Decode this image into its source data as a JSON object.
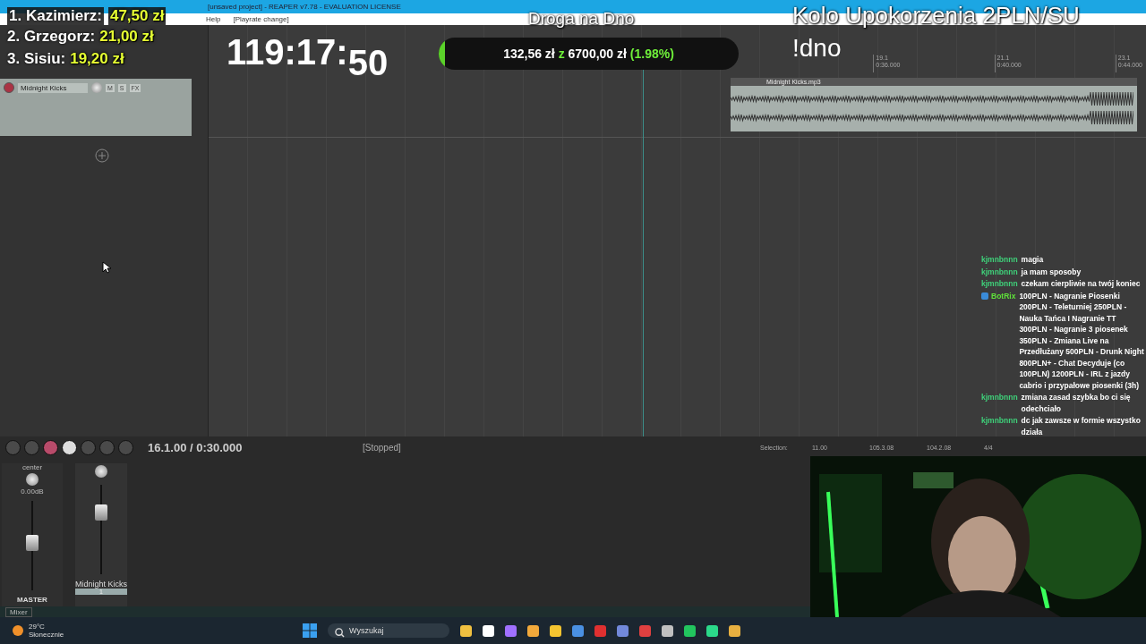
{
  "window": {
    "title": "[unsaved project] - REAPER v7.78 - EVALUATION LICENSE"
  },
  "menu": [
    "Help",
    "[Playrate change]"
  ],
  "overlay": {
    "donors": [
      {
        "rank": "1. Kazimierz:",
        "amount": "47,50 zł"
      },
      {
        "rank": "2. Grzegorz:",
        "amount": "21,00 zł"
      },
      {
        "rank": "3. Sisiu:",
        "amount": "19,20 zł"
      }
    ],
    "timer": "119:17:",
    "timer_seconds": "50",
    "stream_title": "Droga na Dno",
    "wheel_title": "Kolo Upokorzenia 2PLN/SU",
    "command": "!dno",
    "goal": {
      "current": "132,56 zł",
      "joiner": "z",
      "target": "6700,00 zł",
      "percent": "(1.98%)",
      "level": 0.0198
    }
  },
  "ruler": [
    {
      "bar": "19.1",
      "time": "0:36.000"
    },
    {
      "bar": "21.1",
      "time": "0:40.000"
    },
    {
      "bar": "23.1",
      "time": "0:44.000"
    }
  ],
  "track": {
    "name": "Midnight Kicks",
    "buttons": [
      "M",
      "S",
      "FX"
    ],
    "item": "Midnight Kicks.mp3"
  },
  "transport": {
    "position": "16.1.00 / 0:30.000",
    "state": "[Stopped]",
    "selection_label": "Selection:",
    "selection": [
      "11.00",
      "105.3.08",
      "104.2.08"
    ],
    "signature": "4/4"
  },
  "mixer": {
    "master": {
      "pan": "center",
      "volume": "0.00dB",
      "name": "MASTER",
      "level": 0.55
    },
    "channel": {
      "name": "Midnight Kicks",
      "number": "1",
      "level": 0.75
    },
    "tab": "Mixer"
  },
  "chat": [
    {
      "user": "kjmnbnnn",
      "color": "#3fd17a",
      "bot": false,
      "text": "magia"
    },
    {
      "user": "kjmnbnnn",
      "color": "#3fd17a",
      "bot": false,
      "text": "ja mam sposoby"
    },
    {
      "user": "kjmnbnnn",
      "color": "#3fd17a",
      "bot": false,
      "text": "czekam cierpliwie na twój koniec"
    },
    {
      "user": "BotRix",
      "color": "#5fe03a",
      "bot": true,
      "text": "100PLN - Nagranie Piosenki 200PLN - Teleturniej 250PLN - Nauka Tańca I Nagranie TT 300PLN - Nagranie 3 piosenek 350PLN - Zmiana Live na Przedłużany 500PLN - Drunk Night 800PLN+ - Chat Decyduje (co 100PLN) 1200PLN - IRL z jazdy cabrio i przypałowe piosenki (3h)"
    },
    {
      "user": "kjmnbnnn",
      "color": "#3fd17a",
      "bot": false,
      "text": "zmiana zasad szybka bo ci się odechciało"
    },
    {
      "user": "kjmnbnnn",
      "color": "#3fd17a",
      "bot": false,
      "text": "dc jak zawsze w formie wszystko działa"
    }
  ],
  "taskbar": {
    "temperature": "29°C",
    "weather": "Słonecznie",
    "search_placeholder": "Wyszukaj"
  }
}
